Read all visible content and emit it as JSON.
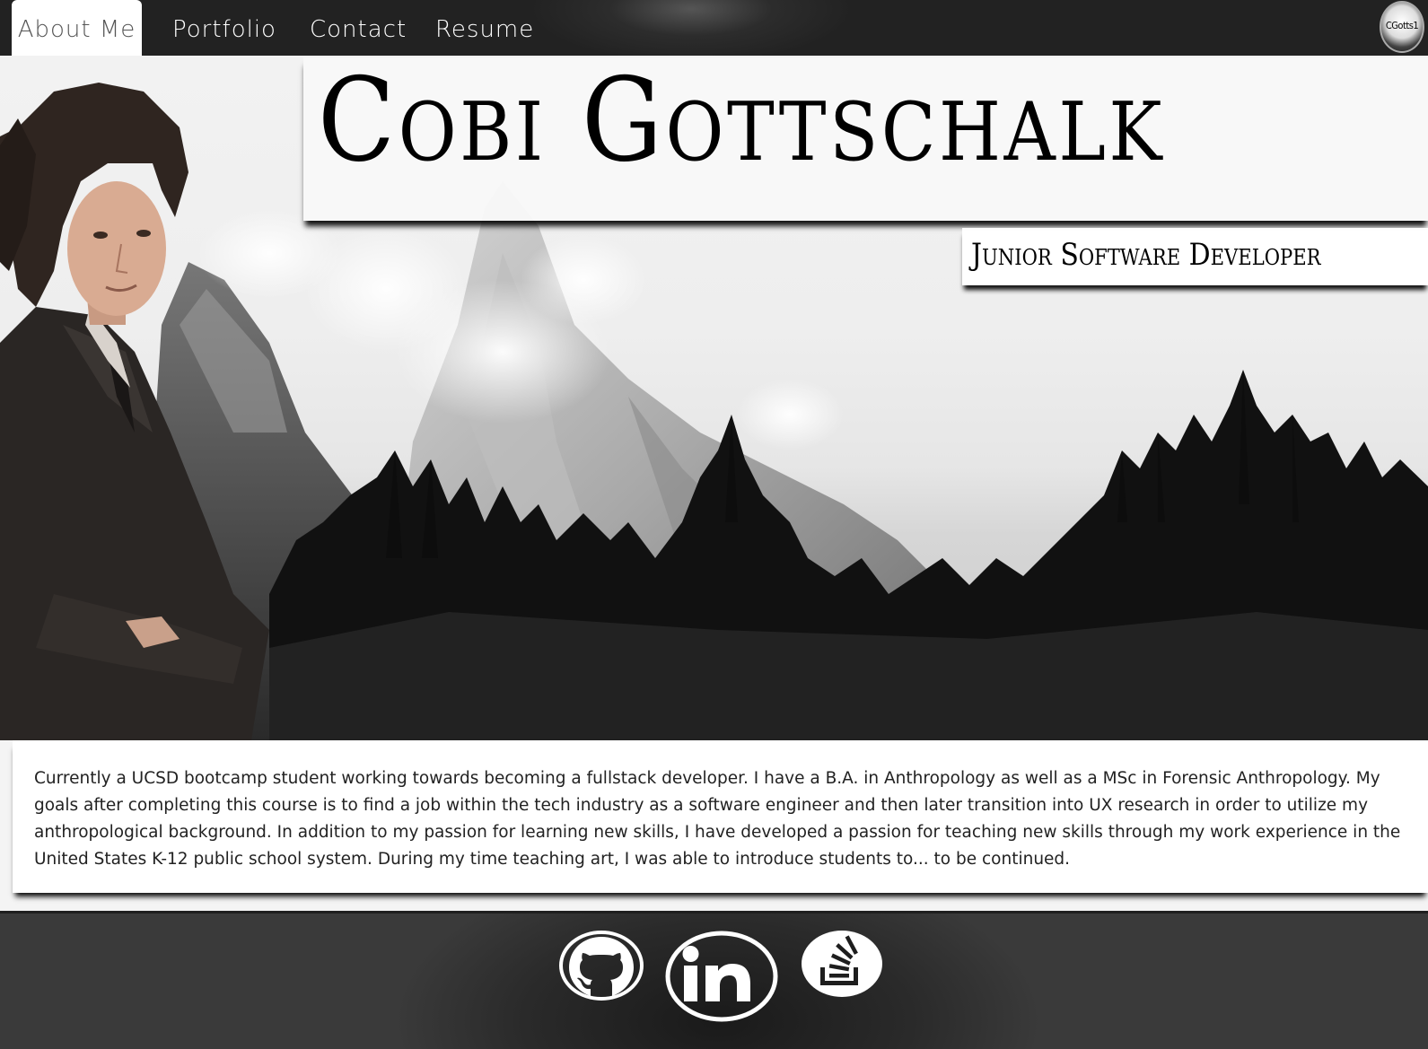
{
  "nav": {
    "tabs": [
      {
        "label": "About Me",
        "active": true
      },
      {
        "label": "Portfolio",
        "active": false
      },
      {
        "label": "Contact",
        "active": false
      },
      {
        "label": "Resume",
        "active": false
      }
    ],
    "brand_text": "CGotts1"
  },
  "hero": {
    "name": "Cobi Gottschalk",
    "title": "Junior Software Developer"
  },
  "about": {
    "text": "Currently a UCSD bootcamp student working towards becoming a fullstack developer. I have a B.A. in Anthropology as well as a MSc in Forensic Anthropology. My goals after completing this course is to find a job within the tech industry as a software engineer and then later transition into UX research in order to utilize my anthropological background. In addition to my passion for learning new skills, I have developed a passion for teaching new skills through my work experience in the United States K-12 public school system. During my time teaching art, I was able to introduce students to... to be continued."
  },
  "footer": {
    "social_icons": [
      "github-icon",
      "linkedin-icon",
      "stackoverflow-icon"
    ]
  },
  "colors": {
    "nav_bg": "#222222",
    "active_tab_bg": "#ffffff",
    "active_tab_text": "#555555",
    "footer_bg": "#2a2a2a"
  }
}
